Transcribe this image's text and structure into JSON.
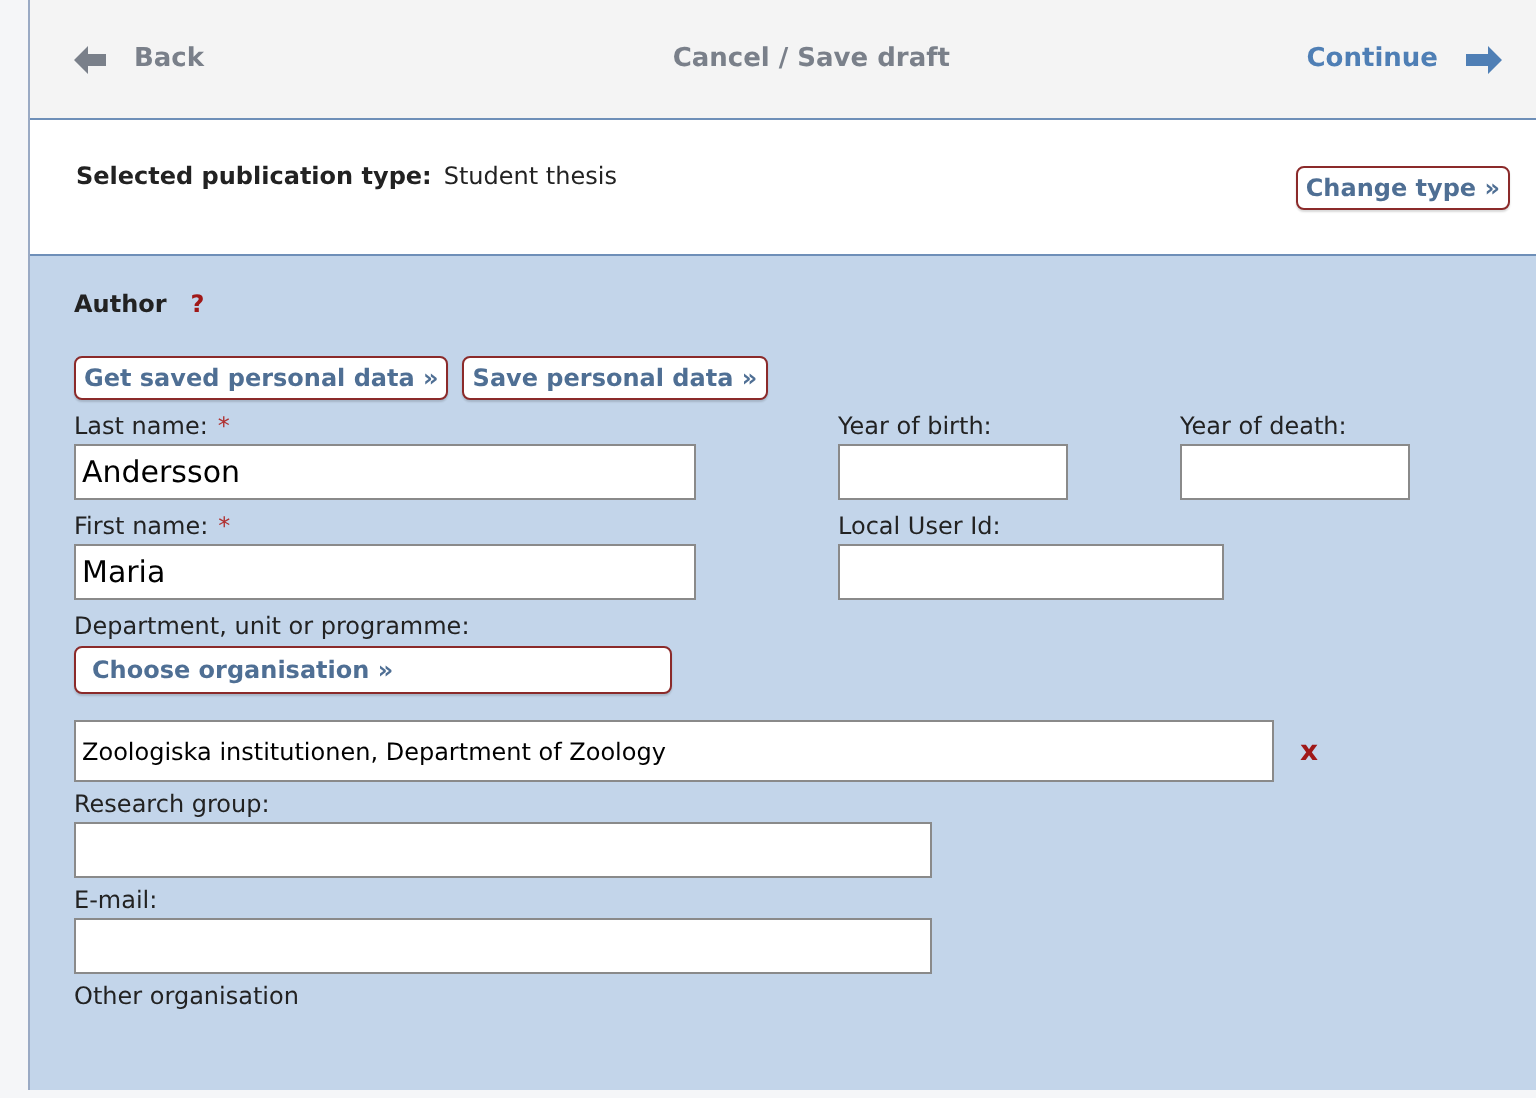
{
  "nav": {
    "back": "Back",
    "middle": "Cancel / Save draft",
    "continue": "Continue"
  },
  "publication_type": {
    "label": "Selected publication type:",
    "value": "Student thesis",
    "button": "Change type »"
  },
  "author": {
    "heading": "Author",
    "help": "?",
    "buttons": [
      "Get saved personal data »",
      "Save personal data »"
    ],
    "last_name": {
      "label": "Last name:",
      "required_mark": "*",
      "value": "Andersson"
    },
    "year_of_birth": {
      "label": "Year of birth:"
    },
    "year_of_death": {
      "label": "Year of death:"
    },
    "first_name": {
      "label": "First name:",
      "required_mark": "*",
      "value": "Maria"
    },
    "local_user_id": {
      "label": "Local User Id:"
    },
    "department": {
      "label": "Department, unit or programme:",
      "button": "Choose organisation »",
      "value": "Zoologiska institutionen, Department of Zoology",
      "remove": "x"
    },
    "research_group": {
      "label": "Research group:"
    },
    "email": {
      "label": "E-mail:"
    },
    "other_organisation": {
      "label": "Other organisation"
    }
  }
}
